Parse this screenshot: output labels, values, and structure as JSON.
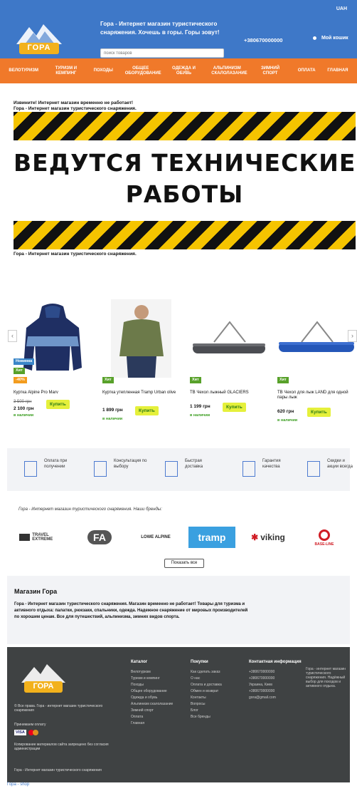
{
  "header": {
    "currency": "UAH",
    "logo_text": "ГОРА",
    "tagline": "Гора - Интернет магазин туристического снаряжения. Хочешь в горы. Горы зовут!",
    "search_placeholder": "поиск товаров",
    "phone": "+380670000000",
    "cart_label": "Мой кошик"
  },
  "nav": {
    "items": [
      "ВЕЛОТУРИЗМ",
      "ТУРИЗМ И КЕМПИНГ",
      "ПОХОДЫ",
      "ОБЩЕЕ ОБОРУДОВАНИЕ",
      "ОДЕЖДА И ОБУВЬ",
      "АЛЬПИНИЗМ СКАЛОЛАЗАНИЕ",
      "ЗИМНИЙ СПОРТ",
      "Оплата",
      "ГЛАВНАЯ"
    ]
  },
  "notice": {
    "line1": "Извините! Интернет магазин временно не работает!",
    "line2": "Гора - Интернет магазин туристического снаряжения.",
    "line3": "Гора - Интернет магазин туристического снаряжения."
  },
  "banner": {
    "line1": "ВЕДУТСЯ ТЕХНИЧЕСКИЕ",
    "line2": "РАБОТЫ"
  },
  "carousel": {
    "prev": "‹",
    "next": "›"
  },
  "products": [
    {
      "name": "Куртка Alpine Pro Marv",
      "badges": [
        "Новинка",
        "Хит",
        "-40%"
      ],
      "old_price": "3 500 грн",
      "price": "2 100 грн",
      "avail": "в наличии",
      "buy": "Купить"
    },
    {
      "name": "Куртка утепленная Tramp Urban olive",
      "badges": [
        "Хит"
      ],
      "old_price": "",
      "price": "1 899 грн",
      "avail": "в наличии",
      "buy": "Купить"
    },
    {
      "name": "ТВ Чехол лыжный GLACIERS",
      "badges": [
        "Хит"
      ],
      "old_price": "",
      "price": "1 199 грн",
      "avail": "в наличии",
      "buy": "Купить"
    },
    {
      "name": "ТВ Чехол для лыж LAND для одной пары лыж",
      "badges": [
        "Хит"
      ],
      "old_price": "",
      "price": "620 грн",
      "avail": "в наличии",
      "buy": "Купить"
    }
  ],
  "advantages": [
    "Оплата при получении",
    "Консультация по выбору",
    "Быстрая доставка",
    "Гарантия качества",
    "Скидки и акции всегда"
  ],
  "brands": {
    "title": "Гора - Интернет магазин туристического снаряжения. Наши бренды:",
    "items": [
      "TRAVEL EXTREME",
      "FA",
      "LOWE ALPINE",
      "tramp",
      "viking",
      "BASE-LINE"
    ],
    "show_all": "Показать все"
  },
  "about": {
    "title": "Магазин Гора",
    "text": "Гора - Интернет магазин туристического снаряжения. Магазин временно не работает! Товары для туризма и активного отдыха: палатки, рюкзаки, спальники, одежда. Надежное снаряжение от мировых производителей по хорошим ценам. Все для путешествий, альпинизма, зимних видов спорта."
  },
  "footer": {
    "logo_text": "ГОРА",
    "info1": "© Все права. Гора - интернет магазин туристического снаряжения",
    "pay_label": "Принимаем оплату",
    "info2": "Копирование материалов сайта запрещено без согласия администрации",
    "info3": "Гора - Интернет магазин туристического снаряжения",
    "col1_title": "Каталог",
    "col1": [
      "Велотуризм",
      "Туризм и кемпинг",
      "Походы",
      "Общее оборудование",
      "Одежда и обувь",
      "Альпинизм скалолазание",
      "Зимний спорт",
      "Оплата",
      "Главная"
    ],
    "col2_title": "Покупки",
    "col2": [
      "Как сделать заказ",
      "О нас",
      "Оплата и доставка",
      "Обмен и возврат",
      "Контакты",
      "Вопросы",
      "Блог",
      "Все бренды"
    ],
    "col3_title": "Контактная информация",
    "col3": [
      "+380670000000",
      "+380670000000",
      "Украина, Киев",
      "+380670000000",
      "gora@gmail.com"
    ],
    "col4": "Гора - интернет магазин туристического снаряжения. Надёжный выбор для походов и активного отдыха."
  },
  "bottom_logo": "Гора - shop"
}
